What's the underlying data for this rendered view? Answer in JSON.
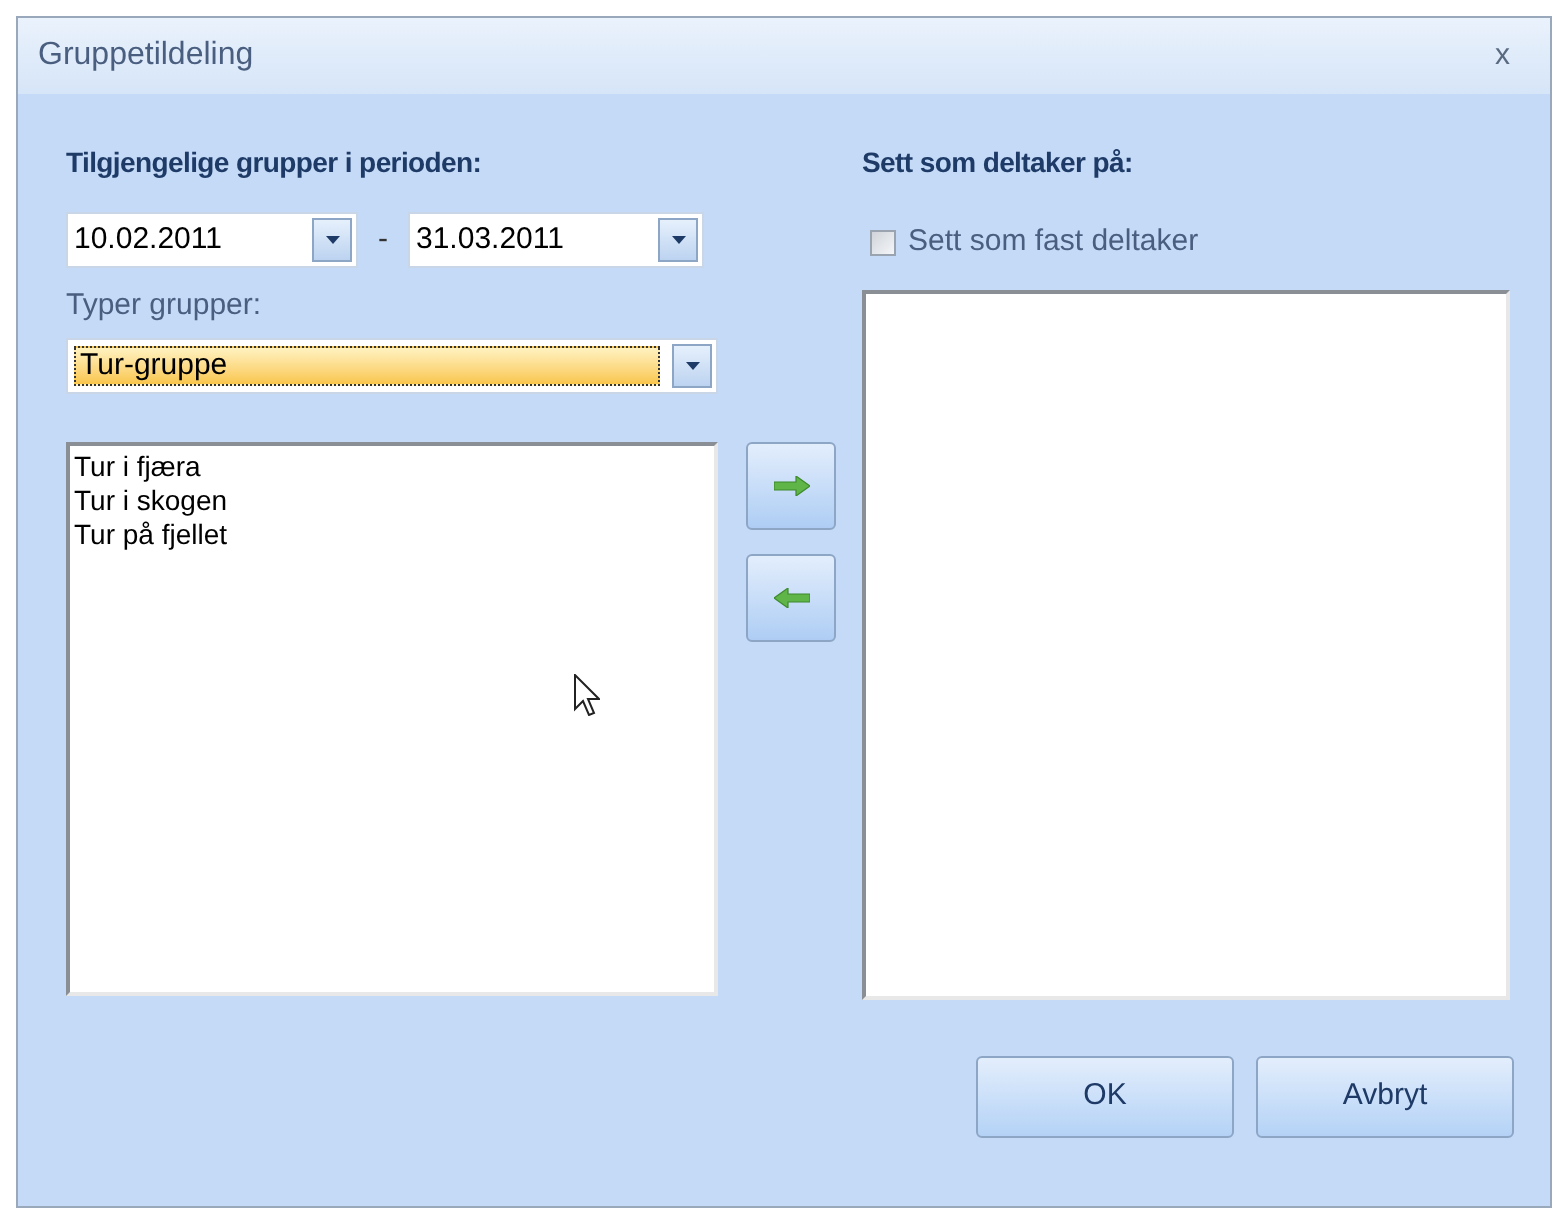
{
  "window": {
    "title": "Gruppetildeling",
    "close": "x"
  },
  "left": {
    "heading": "Tilgjengelige grupper i perioden:",
    "date_from": "10.02.2011",
    "date_separator": "-",
    "date_to": "31.03.2011",
    "type_label": "Typer grupper:",
    "type_value": "Tur-gruppe",
    "groups": [
      {
        "label": "Tur i fjæra"
      },
      {
        "label": "Tur i skogen"
      },
      {
        "label": "Tur på fjellet"
      }
    ]
  },
  "right": {
    "heading": "Sett som deltaker på:",
    "fixed_checkbox": {
      "label": "Sett som fast deltaker",
      "checked": false
    }
  },
  "buttons": [
    "OK",
    "Avbryt"
  ]
}
